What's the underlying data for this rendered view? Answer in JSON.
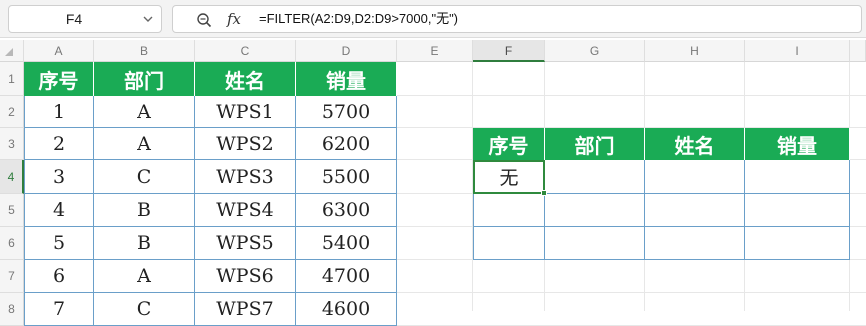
{
  "name_box": {
    "value": "F4"
  },
  "formula_bar": {
    "formula": "=FILTER(A2:D9,D2:D9>7000,\"无\")"
  },
  "columns": [
    "A",
    "B",
    "C",
    "D",
    "E",
    "F",
    "G",
    "H",
    "I"
  ],
  "rows": [
    "1",
    "2",
    "3",
    "4",
    "5",
    "6",
    "7",
    "8"
  ],
  "source_table": {
    "headers": [
      "序号",
      "部门",
      "姓名",
      "销量"
    ],
    "rows": [
      [
        "1",
        "A",
        "WPS1",
        "5700"
      ],
      [
        "2",
        "A",
        "WPS2",
        "6200"
      ],
      [
        "3",
        "C",
        "WPS3",
        "5500"
      ],
      [
        "4",
        "B",
        "WPS4",
        "6300"
      ],
      [
        "5",
        "B",
        "WPS5",
        "5400"
      ],
      [
        "6",
        "A",
        "WPS6",
        "4700"
      ],
      [
        "7",
        "C",
        "WPS7",
        "4600"
      ]
    ]
  },
  "result_table": {
    "headers": [
      "序号",
      "部门",
      "姓名",
      "销量"
    ],
    "rows": [
      [
        "无",
        "",
        "",
        ""
      ],
      [
        "",
        "",
        "",
        ""
      ],
      [
        "",
        "",
        "",
        ""
      ]
    ]
  },
  "colors": {
    "header_green": "#1aab55",
    "selection_green": "#2f8a3d",
    "table_border": "#6a9fc9"
  },
  "icons": {
    "zoom": "zoom-magnifier-icon",
    "fx": "function-fx-icon",
    "dropdown": "chevron-down-icon"
  }
}
